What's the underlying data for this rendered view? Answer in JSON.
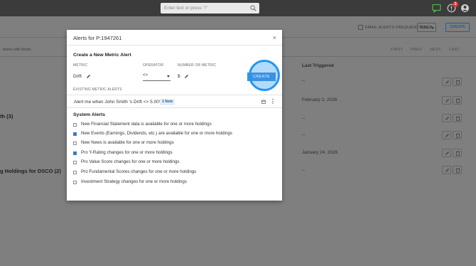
{
  "topbar": {
    "search_placeholder": "Enter text or press \"/\"",
    "notification_count": "3"
  },
  "page": {
    "email_alerts_label": "EMAIL ALERTS FREQUENCY:",
    "frequency_value": "DAILY",
    "create_label": "CREATE",
    "items_with_alerts": "items with Alerts",
    "pager": {
      "first": "FIRST",
      "prev": "PREV",
      "next": "NEXT",
      "last": "LAST"
    },
    "last_triggered_header": "Last Triggered",
    "groups": [
      {
        "label": "th (3)"
      },
      {
        "label": "g Holdings for DSCO (2)"
      }
    ],
    "rows": [
      {
        "last_triggered": "--"
      },
      {
        "last_triggered": "February 2, 2026"
      },
      {
        "last_triggered": "--"
      },
      {
        "last_triggered": "--"
      },
      {
        "last_triggered": "January 24, 2026"
      },
      {
        "last_triggered": "--"
      }
    ]
  },
  "modal": {
    "title": "Alerts for P:1947261",
    "close": "×",
    "create_section": "Create a New Metric Alert",
    "metric_label": "METRIC",
    "operator_label": "OPERATOR",
    "number_label": "NUMBER OR METRIC",
    "metric_value": "Drift",
    "operator_value": "<>",
    "number_value": "$",
    "create_button": "CREATE",
    "existing_label": "EXISTING METRIC ALERTS",
    "existing_alert": "Alert me when John Smith 's Drift <> 5.00%",
    "note_label": "1 Note",
    "system_section": "System Alerts",
    "system_alerts": [
      {
        "label": "New Financial Statement data is available for one or more holdings",
        "checked": false
      },
      {
        "label": "New Events (Earnings, Dividends, etc.) are available for one or more holdings",
        "checked": true
      },
      {
        "label": "New News is available for one or more holdings",
        "checked": false
      },
      {
        "label": "Pro Y-Rating changes for one or more holdings",
        "checked": true
      },
      {
        "label": "Pro Value Score changes for one or more holdings",
        "checked": false
      },
      {
        "label": "Pro Fundamental Scores changes for one or more holdings",
        "checked": false
      },
      {
        "label": "Investment Strategy changes for one or more holdings",
        "checked": false
      }
    ]
  },
  "colors": {
    "topbar": "#3b3b3b",
    "overlay": "#7f7f7f",
    "accent": "#2196f3",
    "create_button": "#4a90d9"
  }
}
